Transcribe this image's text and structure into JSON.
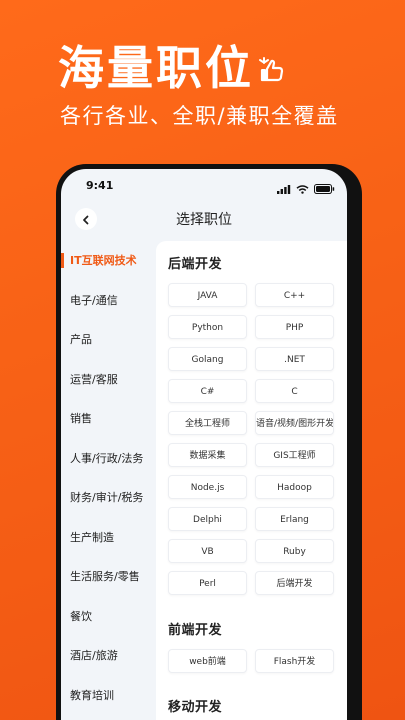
{
  "promo": {
    "headline": "海量职位",
    "subtitle": "各行各业、全职/兼职全覆盖"
  },
  "colors": {
    "brand": "#f05a16",
    "background_gradient_start": "#ff6a1a",
    "background_gradient_end": "#ef5412"
  },
  "status_bar": {
    "time": "9:41"
  },
  "nav": {
    "title": "选择职位"
  },
  "sidebar": {
    "items": [
      {
        "label": "IT互联网技术",
        "active": true
      },
      {
        "label": "电子/通信"
      },
      {
        "label": "产品"
      },
      {
        "label": "运营/客服"
      },
      {
        "label": "销售"
      },
      {
        "label": "人事/行政/法务"
      },
      {
        "label": "财务/审计/税务"
      },
      {
        "label": "生产制造"
      },
      {
        "label": "生活服务/零售"
      },
      {
        "label": "餐饮"
      },
      {
        "label": "酒店/旅游"
      },
      {
        "label": "教育培训"
      }
    ]
  },
  "sections": [
    {
      "title": "后端开发",
      "chips": [
        "JAVA",
        "C++",
        "Python",
        "PHP",
        "Golang",
        ".NET",
        "C#",
        "C",
        "全栈工程师",
        "语音/视频/图形开发",
        "数据采集",
        "GIS工程师",
        "Node.js",
        "Hadoop",
        "Delphi",
        "Erlang",
        "VB",
        "Ruby",
        "Perl",
        "后端开发"
      ]
    },
    {
      "title": "前端开发",
      "chips": [
        "web前端",
        "Flash开发"
      ]
    },
    {
      "title": "移动开发",
      "chips": []
    }
  ]
}
